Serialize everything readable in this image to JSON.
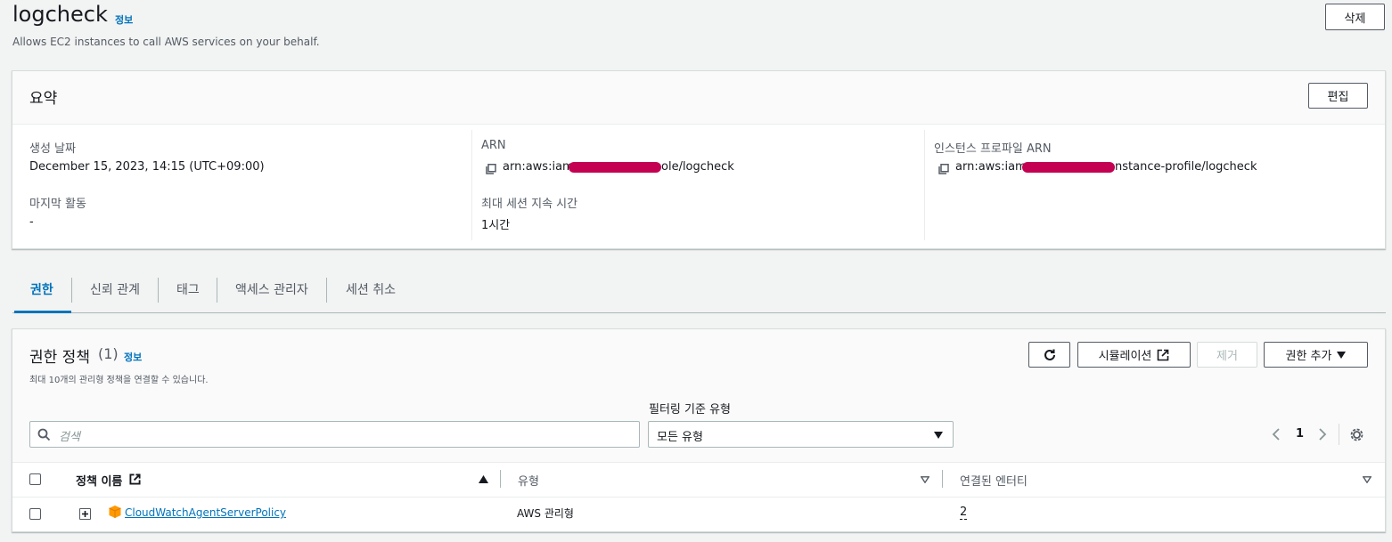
{
  "page": {
    "title": "logcheck",
    "info_label": "정보",
    "description": "Allows EC2 instances to call AWS services on your behalf.",
    "delete_label": "삭제"
  },
  "summary": {
    "title": "요약",
    "edit_label": "편집",
    "created_label": "생성 날짜",
    "created_value": "December 15, 2023, 14:15 (UTC+09:00)",
    "last_activity_label": "마지막 활동",
    "last_activity_value": "-",
    "arn_label": "ARN",
    "arn_prefix": "arn:aws:iam:",
    "arn_suffix": "ole/logcheck",
    "max_session_label": "최대 세션 지속 시간",
    "max_session_value": "1시간",
    "instance_profile_label": "인스턴스 프로파일 ARN",
    "instance_profile_prefix": "arn:aws:iam:",
    "instance_profile_suffix": "nstance-profile/logcheck",
    "redaction_color": "#c30052"
  },
  "tabs": [
    {
      "label": "권한",
      "active": true
    },
    {
      "label": "신뢰 관계",
      "active": false
    },
    {
      "label": "태그",
      "active": false
    },
    {
      "label": "액세스 관리자",
      "active": false
    },
    {
      "label": "세션 취소",
      "active": false
    }
  ],
  "policies": {
    "title": "권한 정책",
    "count": "(1)",
    "info_label": "정보",
    "subtitle": "최대 10개의 관리형 정책을 연결할 수 있습니다.",
    "refresh_icon": "refresh-icon",
    "simulate_label": "시뮬레이션",
    "remove_label": "제거",
    "add_label": "권한 추가",
    "filter_type_label": "필터링 기준 유형",
    "search_placeholder": "검색",
    "filter_value": "모든 유형",
    "page_number": "1",
    "columns": {
      "name": "정책 이름",
      "type": "유형",
      "entities": "연결된 엔터티"
    },
    "rows": [
      {
        "name": "CloudWatchAgentServerPolicy",
        "type": "AWS 관리형",
        "entities": "2"
      }
    ]
  },
  "colors": {
    "accent": "#0073bb",
    "aws_orange": "#ff9900",
    "text": "#16191f",
    "muted": "#545b64"
  }
}
